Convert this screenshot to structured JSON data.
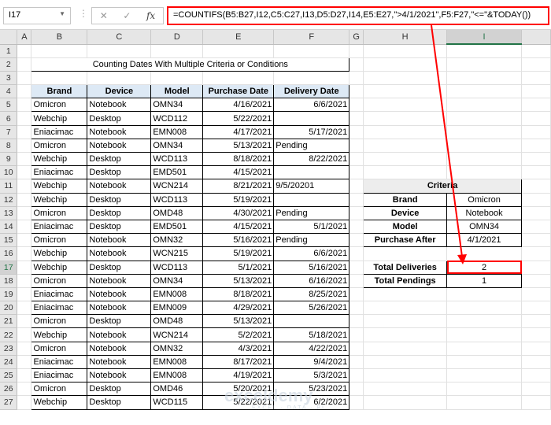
{
  "formula_bar": {
    "name_box": "I17",
    "formula": "=COUNTIFS(B5:B27,I12,C5:C27,I13,D5:D27,I14,E5:E27,\">4/1/2021\",F5:F27,\"<=\"&TODAY())",
    "cancel_icon": "✕",
    "enter_icon": "✓",
    "fx_icon": "fx"
  },
  "columns": [
    "A",
    "B",
    "C",
    "D",
    "E",
    "F",
    "G",
    "H",
    "I"
  ],
  "row_numbers": [
    "1",
    "2",
    "3",
    "4",
    "5",
    "6",
    "7",
    "8",
    "9",
    "10",
    "11",
    "12",
    "13",
    "14",
    "15",
    "16",
    "17",
    "18",
    "19",
    "20",
    "21",
    "22",
    "23",
    "24",
    "25",
    "26",
    "27"
  ],
  "title": "Counting Dates With Multiple Criteria or Conditions",
  "table": {
    "headers": [
      "Brand",
      "Device",
      "Model",
      "Purchase Date",
      "Delivery Date"
    ],
    "rows": [
      [
        "Omicron",
        "Notebook",
        "OMN34",
        "4/16/2021",
        "6/6/2021"
      ],
      [
        "Webchip",
        "Desktop",
        "WCD112",
        "5/22/2021",
        ""
      ],
      [
        "Eniacimac",
        "Notebook",
        "EMN008",
        "4/17/2021",
        "5/17/2021"
      ],
      [
        "Omicron",
        "Notebook",
        "OMN34",
        "5/13/2021",
        "Pending"
      ],
      [
        "Webchip",
        "Desktop",
        "WCD113",
        "8/18/2021",
        "8/22/2021"
      ],
      [
        "Eniacimac",
        "Desktop",
        "EMD501",
        "4/15/2021",
        ""
      ],
      [
        "Webchip",
        "Notebook",
        "WCN214",
        "8/21/2021",
        "9/5/20201"
      ],
      [
        "Webchip",
        "Desktop",
        "WCD113",
        "5/19/2021",
        ""
      ],
      [
        "Omicron",
        "Desktop",
        "OMD48",
        "4/30/2021",
        "Pending"
      ],
      [
        "Eniacimac",
        "Desktop",
        "EMD501",
        "4/15/2021",
        "5/1/2021"
      ],
      [
        "Omicron",
        "Notebook",
        "OMN32",
        "5/16/2021",
        "Pending"
      ],
      [
        "Webchip",
        "Notebook",
        "WCN215",
        "5/19/2021",
        "6/6/2021"
      ],
      [
        "Webchip",
        "Desktop",
        "WCD113",
        "5/1/2021",
        "5/16/2021"
      ],
      [
        "Omicron",
        "Notebook",
        "OMN34",
        "5/13/2021",
        "6/16/2021"
      ],
      [
        "Eniacimac",
        "Notebook",
        "EMN008",
        "8/18/2021",
        "8/25/2021"
      ],
      [
        "Eniacimac",
        "Notebook",
        "EMN009",
        "4/29/2021",
        "5/26/2021"
      ],
      [
        "Omicron",
        "Desktop",
        "OMD48",
        "5/13/2021",
        ""
      ],
      [
        "Webchip",
        "Notebook",
        "WCN214",
        "5/2/2021",
        "5/18/2021"
      ],
      [
        "Omicron",
        "Notebook",
        "OMN32",
        "4/3/2021",
        "4/22/2021"
      ],
      [
        "Eniacimac",
        "Notebook",
        "EMN008",
        "8/17/2021",
        "9/4/2021"
      ],
      [
        "Eniacimac",
        "Notebook",
        "EMN008",
        "4/19/2021",
        "5/3/2021"
      ],
      [
        "Omicron",
        "Desktop",
        "OMD46",
        "5/20/2021",
        "5/23/2021"
      ],
      [
        "Webchip",
        "Desktop",
        "WCD115",
        "5/22/2021",
        "6/2/2021"
      ]
    ]
  },
  "criteria": {
    "header": "Criteria",
    "rows": [
      [
        "Brand",
        "Omicron"
      ],
      [
        "Device",
        "Notebook"
      ],
      [
        "Model",
        "OMN34"
      ],
      [
        "Purchase After",
        "4/1/2021"
      ]
    ]
  },
  "results": {
    "rows": [
      [
        "Total Deliveries",
        "2"
      ],
      [
        "Total Pendings",
        "1"
      ]
    ]
  },
  "watermark": {
    "logo": "exceldemy",
    "tag": "EXCEL · DATA · BI"
  },
  "colors": {
    "highlight": "#ff0000",
    "header_fill": "#dde9f5",
    "selected_col": "#217346"
  }
}
